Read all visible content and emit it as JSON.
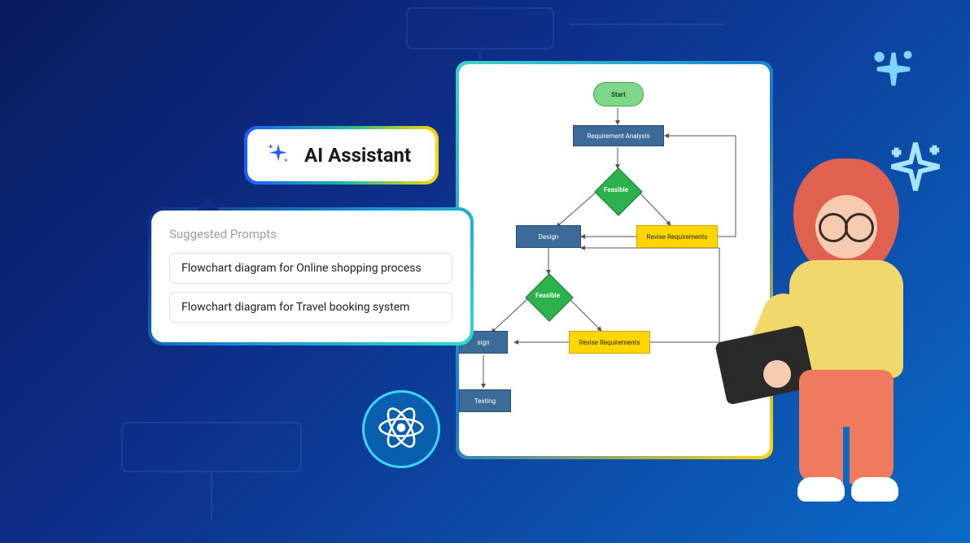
{
  "ai_assistant": {
    "label": "AI Assistant"
  },
  "prompts": {
    "heading": "Suggested Prompts",
    "items": [
      "Flowchart diagram for Online shopping process",
      "Flowchart diagram for Travel booking system"
    ]
  },
  "flowchart": {
    "start": "Start",
    "req_analysis": "Requirement Analysis",
    "feasible_1": "Feasible",
    "design_1": "Design",
    "revise_1": "Revise Requirements",
    "feasible_2": "Feasible",
    "design_2": "sign",
    "revise_2": "Revise Requirements",
    "testing": "Testing"
  },
  "icons": {
    "sparkle": "sparkle-icon",
    "react": "react-icon"
  },
  "colors": {
    "bg_start": "#0a1b5e",
    "bg_end": "#0a6bc7",
    "accent_teal": "#2de0c8",
    "accent_yellow": "#ffd600",
    "node_blue": "#3d6b99",
    "node_green": "#2bb24c",
    "node_start": "#7fd88a"
  }
}
